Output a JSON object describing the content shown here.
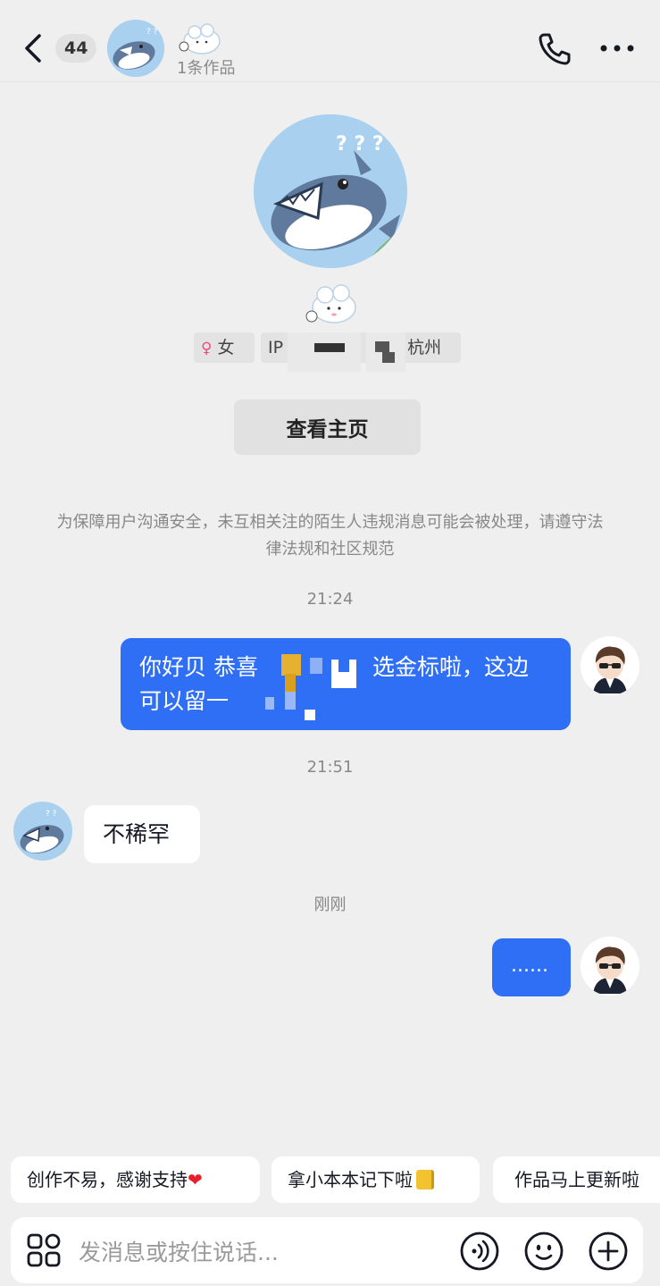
{
  "header": {
    "unread_count": "44",
    "subtitle": "1条作品"
  },
  "profile": {
    "gender_symbol": "♀",
    "gender": "女",
    "ip_prefix": "IP",
    "location": "· 杭州",
    "view_home_label": "查看主页"
  },
  "notice": "为保障用户沟通安全，未互相关注的陌生人违规消息可能会被处理，请遵守法律法规和社区规范",
  "messages": [
    {
      "time": "21:24",
      "line1_a": "你好贝 恭喜",
      "line1_b": "选金标啦，这边",
      "line2": "可以留一"
    },
    {
      "time": "21:51",
      "text": "不稀罕"
    },
    {
      "time": "刚刚",
      "text": "......"
    }
  ],
  "quick_replies": [
    {
      "text": "创作不易，感谢支持",
      "emoji": "❤"
    },
    {
      "text": "拿小本本记下啦",
      "emoji": ""
    },
    {
      "text": "作品马上更新啦"
    }
  ],
  "input": {
    "placeholder": "发消息或按住说话..."
  },
  "colors": {
    "bubble_out": "#2f6ff6",
    "background": "#efefef"
  }
}
